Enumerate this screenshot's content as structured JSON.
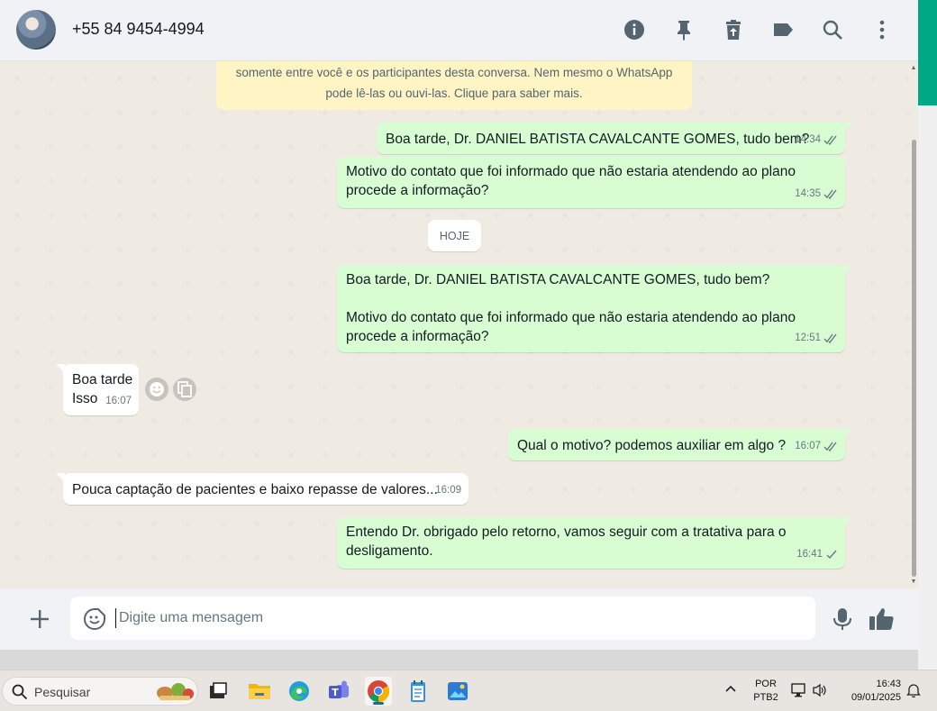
{
  "header": {
    "contact_name": "+55 84 9454-4994",
    "icons": [
      "info-icon",
      "pin-icon",
      "delete-icon",
      "label-icon",
      "search-icon",
      "menu-icon"
    ]
  },
  "chat": {
    "e2e_notice_line1": "somente entre você e os participantes desta conversa. Nem mesmo o WhatsApp",
    "e2e_notice_line2": "pode lê-las ou ouvi-las. Clique para saber mais.",
    "date_chip": "HOJE",
    "messages": [
      {
        "direction": "out",
        "text": "Boa tarde, Dr. DANIEL BATISTA CAVALCANTE GOMES, tudo bem?",
        "time": "14:34",
        "status": "read"
      },
      {
        "direction": "out",
        "text": "Motivo do contato que foi informado que não estaria atendendo ao plano\nprocede a informação?",
        "time": "14:35",
        "status": "read"
      },
      {
        "direction": "out",
        "text": "Boa tarde, Dr. DANIEL BATISTA CAVALCANTE GOMES, tudo bem?\n\nMotivo do contato que foi informado que não estaria atendendo ao plano\nprocede a informação?",
        "time": "12:51",
        "status": "read"
      },
      {
        "direction": "in",
        "text": "Boa tarde\nIsso",
        "time": "16:07"
      },
      {
        "direction": "out",
        "text": "Qual o motivo? podemos auxiliar em algo ?",
        "time": "16:07",
        "status": "read"
      },
      {
        "direction": "in",
        "text": "Pouca captação de pacientes e baixo repasse de valores...",
        "time": "16:09"
      },
      {
        "direction": "out",
        "text": "Entendo Dr. obrigado pelo retorno, vamos seguir com a tratativa para o\ndesligamento.",
        "time": "16:41",
        "status": "sent"
      }
    ]
  },
  "composer": {
    "placeholder": "Digite uma mensagem"
  },
  "taskbar": {
    "search_label": "Pesquisar",
    "lang_line1": "POR",
    "lang_line2": "PTB2",
    "time": "16:43",
    "date": "09/01/2025"
  },
  "colors": {
    "outgoing_bubble": "#d9fdd3",
    "incoming_bubble": "#ffffff",
    "accent": "#00a884",
    "read_tick": "#667781"
  }
}
